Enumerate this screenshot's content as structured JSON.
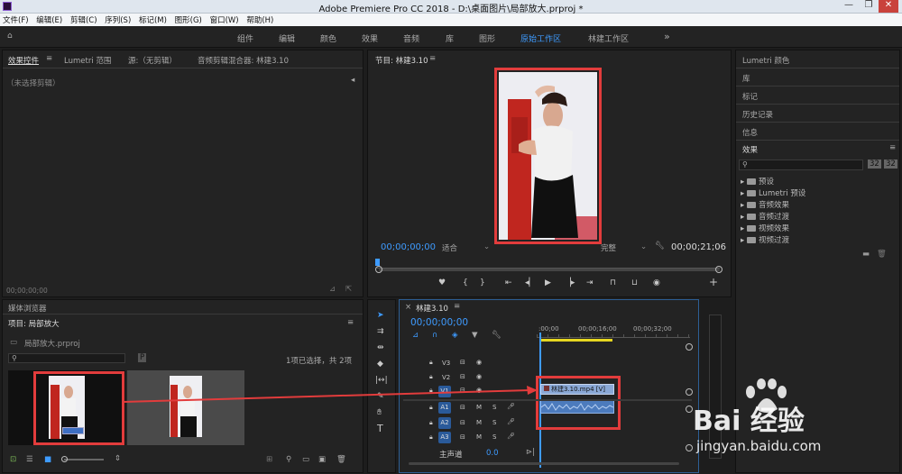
{
  "window": {
    "title": "Adobe Premiere Pro CC 2018 - D:\\桌面图片\\局部放大.prproj *",
    "minimize": "—",
    "restore": "❐",
    "close": "✕"
  },
  "menu": [
    "文件(F)",
    "编辑(E)",
    "剪辑(C)",
    "序列(S)",
    "标记(M)",
    "图形(G)",
    "窗口(W)",
    "帮助(H)"
  ],
  "workspaces": {
    "items": [
      "组件",
      "编辑",
      "颜色",
      "效果",
      "音频",
      "库",
      "图形",
      "原始工作区",
      "林建工作区"
    ],
    "active_index": 7,
    "overflow": "»"
  },
  "source_panel": {
    "tabs": [
      "效果控件",
      "Lumetri 范围",
      "源:（无剪辑）",
      "音频剪辑混合器: 林建3.10"
    ],
    "menu_glyph": "≡",
    "no_clip": "（未选择剪辑）",
    "timecode": "00;00;00;00"
  },
  "program": {
    "tab": "节目: 林建3.10",
    "timecode_in": "00;00;00;00",
    "fit": "适合",
    "quality": "完整",
    "timecode_out": "00;00;21;06"
  },
  "media_browser": {
    "tab": "媒体浏览器"
  },
  "project": {
    "tab": "项目: 局部放大",
    "file": "局部放大.prproj",
    "selection": "1项已选择，共 2项",
    "search_placeholder": "",
    "items": [
      "林建3.10.mp4",
      "局部放大.prproj"
    ]
  },
  "timeline": {
    "tab": "林建3.10",
    "timecode": "00;00;00;00",
    "ruler": [
      ":00;00",
      "00;00;16;00",
      "00;00;32;00"
    ],
    "video_tracks": [
      "V3",
      "V2",
      "V1"
    ],
    "audio_tracks": [
      "A1",
      "A2",
      "A3"
    ],
    "master": "主声道",
    "master_value": "0.0",
    "clip_label": "林建3.10.mp4 [V]"
  },
  "right_panels": {
    "items": [
      "Lumetri 颜色",
      "库",
      "标记",
      "历史记录",
      "信息"
    ],
    "effects_tab": "效果",
    "effects_tree": [
      "预设",
      "Lumetri 预设",
      "音频效果",
      "音频过渡",
      "视频效果",
      "视频过渡"
    ]
  },
  "watermark": {
    "brand": "Bai 经验",
    "url": "jingyan.baidu.com"
  },
  "colors": {
    "accent": "#3e9bff",
    "highlight": "#e23c3c",
    "clip_video": "#8aa8d6",
    "clip_audio": "#4c7bbd"
  }
}
